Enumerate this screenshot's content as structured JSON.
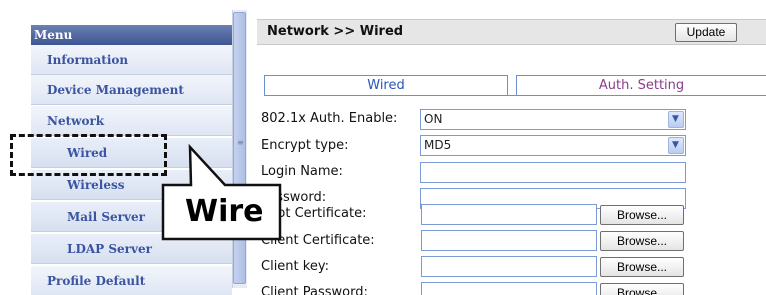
{
  "menu": {
    "header": "Menu",
    "items": [
      {
        "label": "Information",
        "level": 1
      },
      {
        "label": "Device Management",
        "level": 1
      },
      {
        "label": "Network",
        "level": 1
      },
      {
        "label": "Wired",
        "level": 2
      },
      {
        "label": "Wireless",
        "level": 2
      },
      {
        "label": "Mail Server",
        "level": 2
      },
      {
        "label": "LDAP Server",
        "level": 2
      },
      {
        "label": "Profile Default",
        "level": 1
      }
    ]
  },
  "header": {
    "title": "Network >> Wired",
    "update_label": "Update"
  },
  "tabs": [
    {
      "label": "Wired",
      "active": false
    },
    {
      "label": "Auth. Setting",
      "active": true
    }
  ],
  "form": {
    "auth_enable": {
      "label": "802.1x Auth. Enable:",
      "value": "ON"
    },
    "encrypt_type": {
      "label": "Encrypt type:",
      "value": "MD5"
    },
    "login_name": {
      "label": "Login Name:",
      "value": ""
    },
    "password": {
      "label": "Password:",
      "value": ""
    },
    "root_cert": {
      "label": "Root Certificate:",
      "button": "Browse..."
    },
    "client_cert": {
      "label": "Client Certificate:",
      "button": "Browse..."
    },
    "client_key": {
      "label": "Client key:",
      "button": "Browse..."
    },
    "client_password": {
      "label": "Client Password:",
      "button": "Browse..."
    }
  },
  "callout": {
    "text": "Wire"
  },
  "icons": {
    "dropdown": "chevron-down-icon",
    "scroll_grip": "grip-icon"
  },
  "colors": {
    "menu_link": "#3a54a0",
    "tab_border": "#6c8fd0",
    "active_tab_text": "#8c3c8c"
  }
}
